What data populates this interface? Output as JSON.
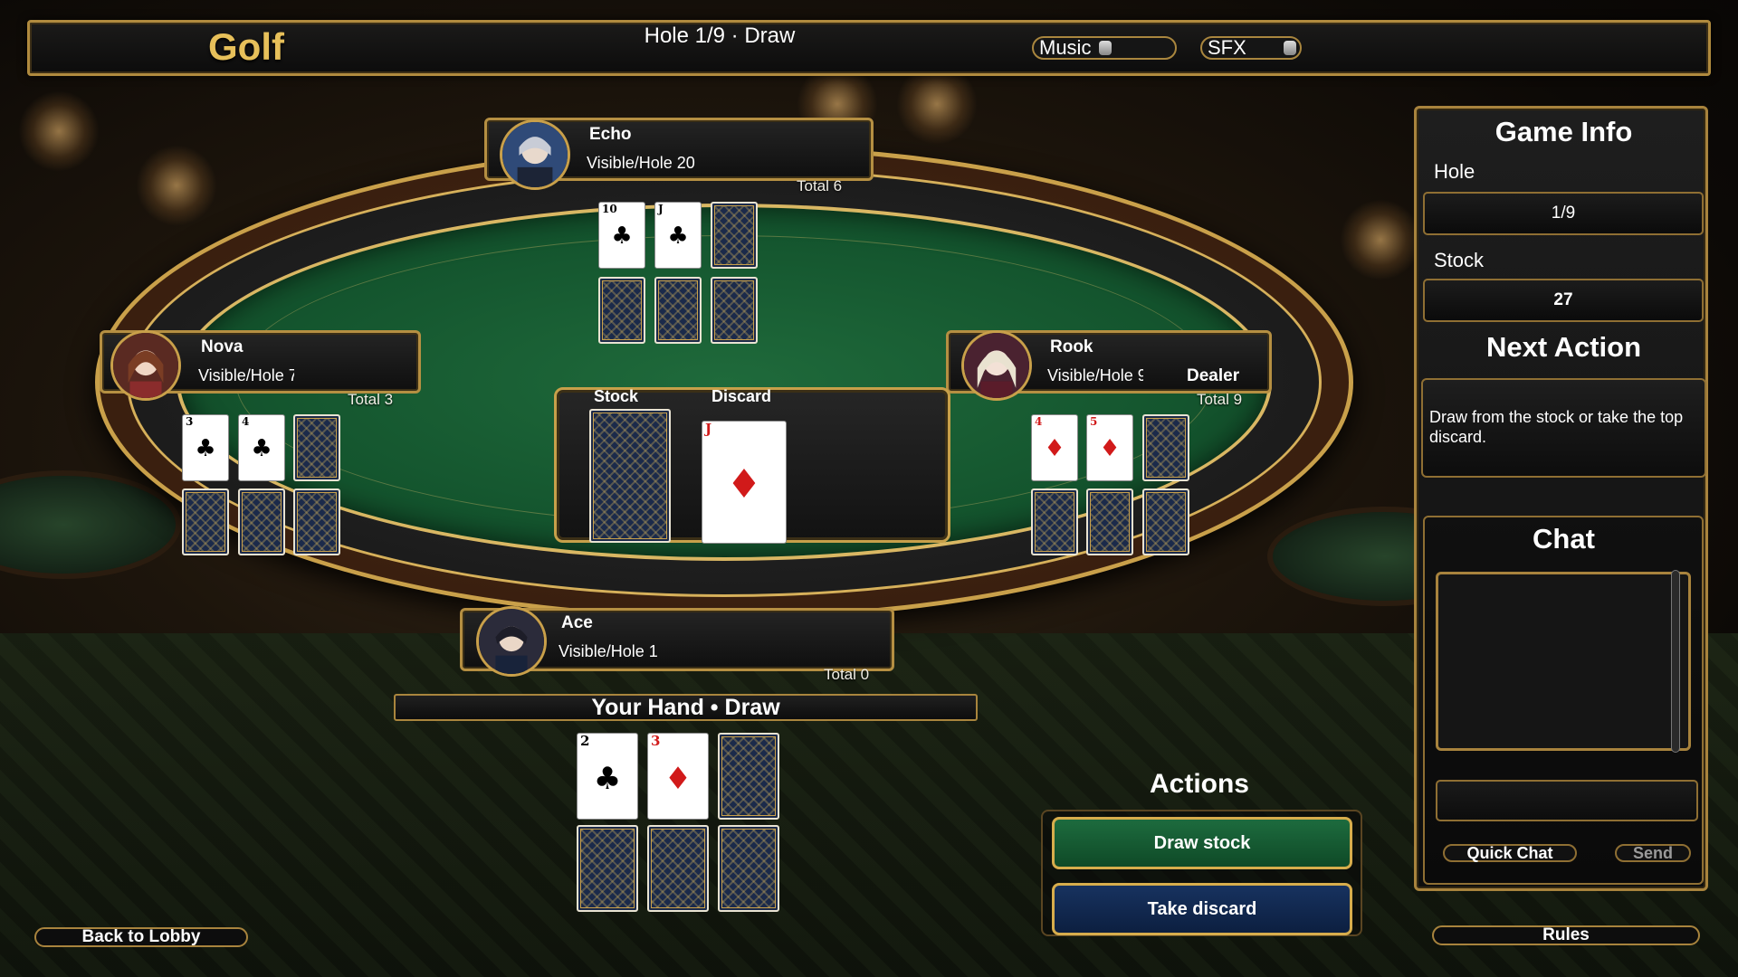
{
  "header": {
    "title": "Golf",
    "status": "Hole 1/9 · Draw",
    "music_label": "Music",
    "sfx_label": "SFX"
  },
  "players": {
    "echo": {
      "name": "Echo",
      "visible": "Visible/Hole 20",
      "total": "Total 6"
    },
    "nova": {
      "name": "Nova",
      "visible": "Visible/Hole 7",
      "total": "Total 3"
    },
    "rook": {
      "name": "Rook",
      "visible": "Visible/Hole 9",
      "total": "Total 9",
      "badge": "Dealer"
    },
    "ace": {
      "name": "Ace",
      "visible": "Visible/Hole 1",
      "total": "Total 0"
    }
  },
  "cards": {
    "echo": [
      {
        "rank": "10",
        "suit": "♣",
        "color": "black"
      },
      {
        "rank": "J",
        "suit": "♣",
        "color": "black"
      }
    ],
    "nova": [
      {
        "rank": "3",
        "suit": "♣",
        "color": "black"
      },
      {
        "rank": "4",
        "suit": "♣",
        "color": "black"
      }
    ],
    "rook": [
      {
        "rank": "4",
        "suit": "♦",
        "color": "red"
      },
      {
        "rank": "5",
        "suit": "♦",
        "color": "red"
      }
    ],
    "hand": [
      {
        "rank": "2",
        "suit": "♣",
        "color": "black"
      },
      {
        "rank": "3",
        "suit": "♦",
        "color": "red"
      }
    ],
    "discard_top": {
      "rank": "J",
      "suit": "♦",
      "color": "red"
    }
  },
  "center": {
    "stock_label": "Stock",
    "discard_label": "Discard"
  },
  "hand_banner": "Your Hand  •  Draw",
  "actions": {
    "title": "Actions",
    "draw_stock": "Draw stock",
    "take_discard": "Take discard"
  },
  "game_info": {
    "title": "Game Info",
    "hole_label": "Hole",
    "hole_value": "1/9",
    "stock_label": "Stock",
    "stock_value": "27",
    "next_action_title": "Next Action",
    "next_action_text": "Draw from the stock or take the top discard."
  },
  "chat": {
    "title": "Chat",
    "quick_chat": "Quick Chat",
    "send": "Send"
  },
  "footer": {
    "back_to_lobby": "Back to Lobby",
    "rules": "Rules"
  },
  "colors": {
    "gold": "#c9a04a",
    "felt": "#14552e",
    "accent_title": "#e7c05a"
  }
}
